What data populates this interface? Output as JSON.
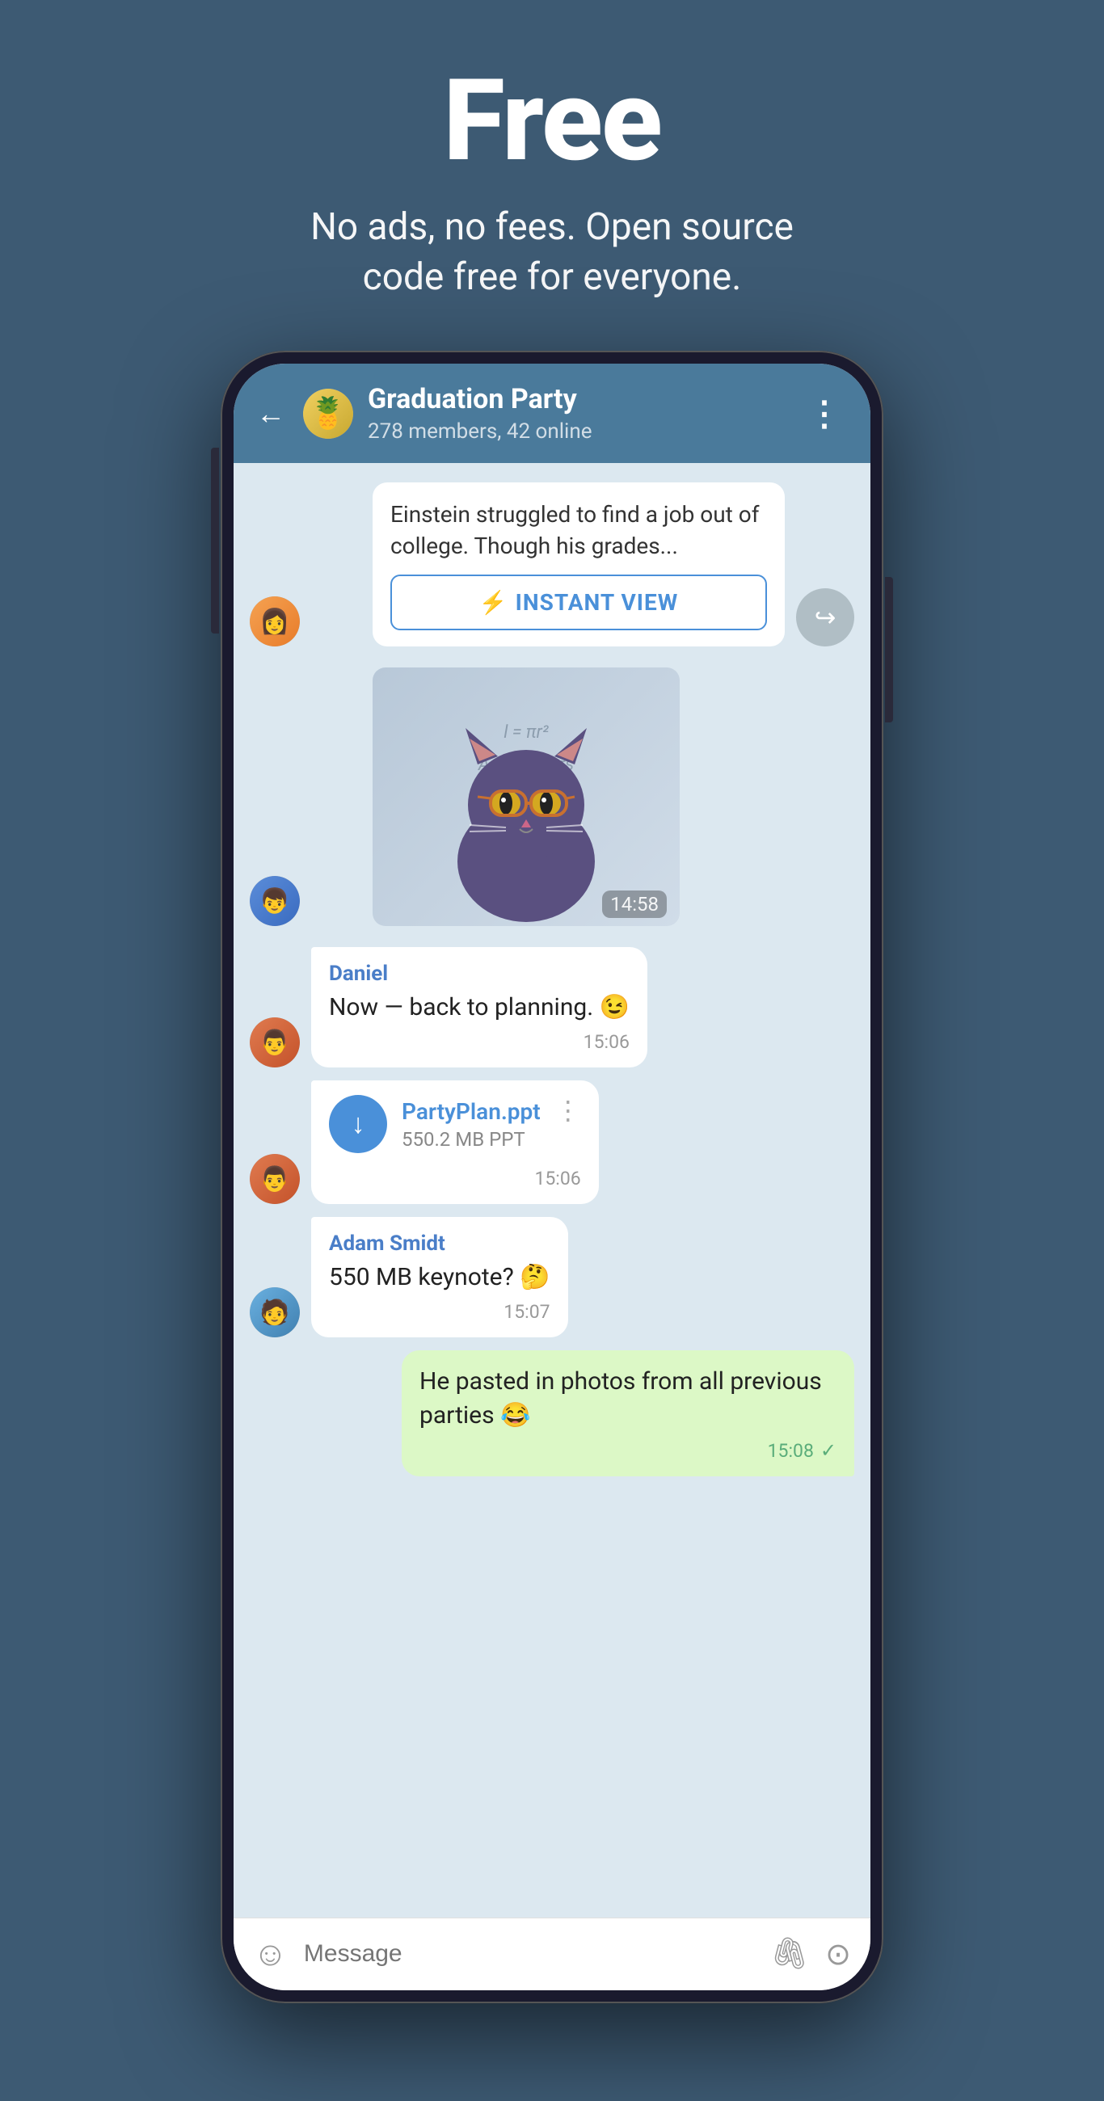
{
  "hero": {
    "title": "Free",
    "subtitle": "No ads, no fees. Open source code free for everyone.",
    "bg_color": "#3d5a73"
  },
  "phone": {
    "header": {
      "back_label": "←",
      "group_name": "Graduation Party",
      "group_meta": "278 members, 42 online",
      "more_icon": "⋮"
    },
    "messages": [
      {
        "id": "msg-iv",
        "type": "instant_view",
        "text": "Einstein struggled to find a job out of college. Though his grades...",
        "button_label": "INSTANT VIEW"
      },
      {
        "id": "msg-sticker",
        "type": "sticker",
        "time": "14:58"
      },
      {
        "id": "msg-daniel",
        "type": "text",
        "sender": "Daniel",
        "text": "Now — back to planning. 😉",
        "time": "15:06"
      },
      {
        "id": "msg-file",
        "type": "file",
        "filename": "PartyPlan.ppt",
        "filesize": "550.2 MB PPT",
        "time": "15:06"
      },
      {
        "id": "msg-adam",
        "type": "text",
        "sender": "Adam Smidt",
        "text": "550 MB keynote? 🤔",
        "time": "15:07"
      },
      {
        "id": "msg-outgoing",
        "type": "text_outgoing",
        "text": "He pasted in photos from all previous parties 😂",
        "time": "15:08",
        "checkmark": "✓"
      }
    ],
    "input": {
      "placeholder": "Message",
      "emoji_icon": "☺",
      "attach_icon": "📎",
      "camera_icon": "⊙"
    }
  }
}
